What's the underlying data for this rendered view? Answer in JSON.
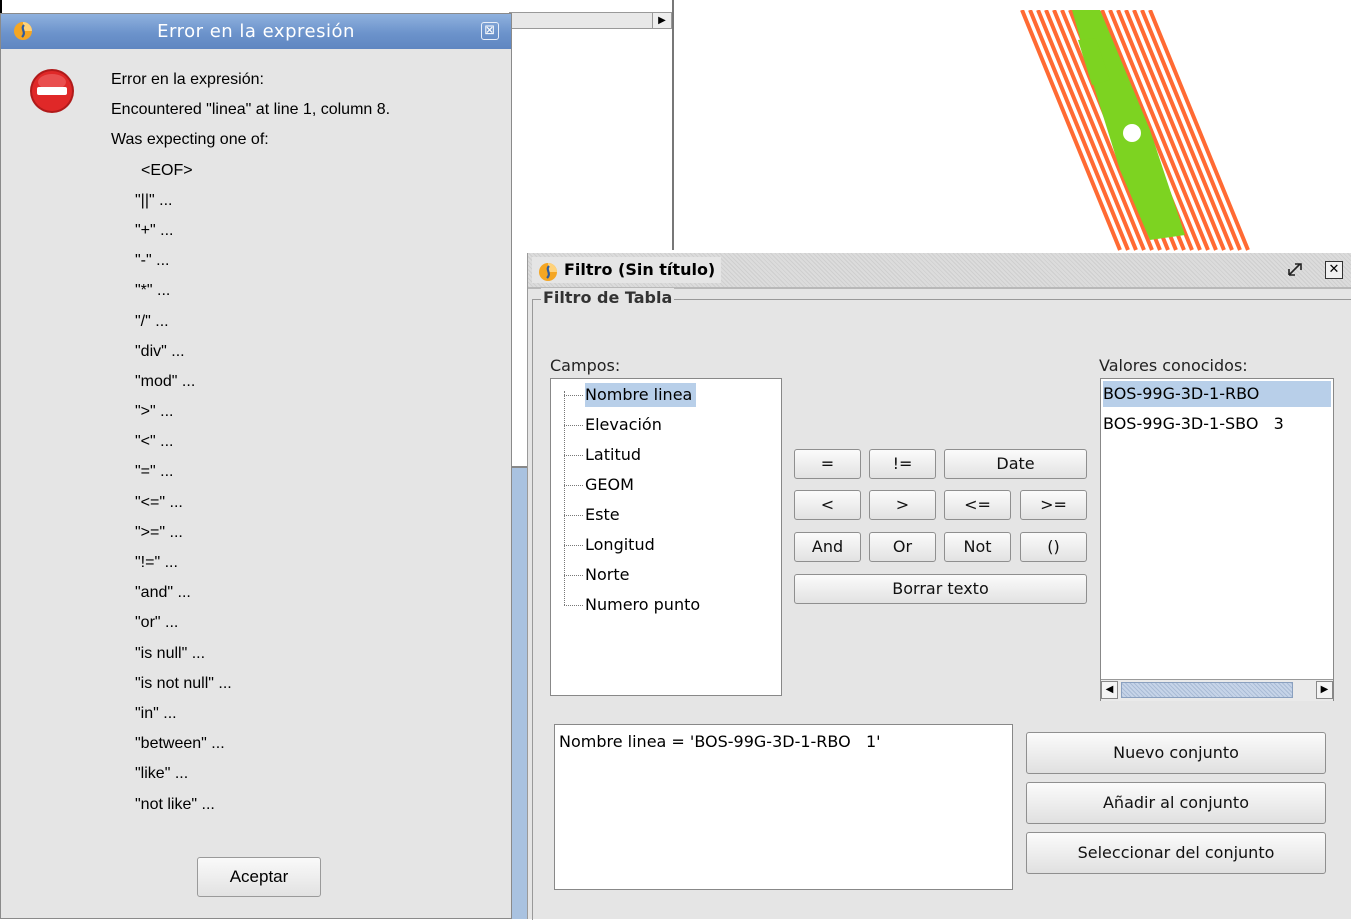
{
  "error_dialog": {
    "title": "Error en la expresión",
    "close_glyph": "⊠",
    "message_lines": [
      "Error en la expresión:",
      "Encountered \"linea\" at line 1, column 8.",
      "Was expecting one of:"
    ],
    "expected_tokens": [
      "<EOF>",
      "\"||\" ...",
      "\"+\" ...",
      "\"-\" ...",
      "\"*\" ...",
      "\"/\" ...",
      "\"div\" ...",
      "\"mod\" ...",
      "\">\" ...",
      "\"<\" ...",
      "\"=\" ...",
      "\"<=\" ...",
      "\">=\" ...",
      "\"!=\" ...",
      "\"and\" ...",
      "\"or\" ...",
      "\"is null\" ...",
      "\"is not null\" ...",
      "\"in\" ...",
      "\"between\" ...",
      "\"like\" ...",
      "\"not like\" ..."
    ],
    "accept_label": "Aceptar",
    "icon": "error-stop-icon"
  },
  "filter_window": {
    "title": "Filtro (Sin título)",
    "group_title": "Filtro de Tabla",
    "fields_label": "Campos:",
    "fields": [
      "Nombre linea",
      "Elevación",
      "Latitud",
      "GEOM",
      "Este",
      "Longitud",
      "Norte",
      "Numero punto"
    ],
    "selected_field": "Nombre linea",
    "operators": {
      "eq": "=",
      "neq": "!=",
      "date": "Date",
      "lt": "<",
      "gt": ">",
      "lte": "<=",
      "gte": ">=",
      "and": "And",
      "or": "Or",
      "not": "Not",
      "parens": "()",
      "clear": "Borrar texto"
    },
    "known_values_label": "Valores conocidos:",
    "known_values": [
      "BOS-99G-3D-1-RBO",
      "BOS-99G-3D-1-SBO   3"
    ],
    "expression": "Nombre linea = 'BOS-99G-3D-1-RBO   1'",
    "set_buttons": {
      "new_set": "Nuevo conjunto",
      "add_to_set": "Añadir al conjunto",
      "select_from_set": "Seleccionar del conjunto"
    }
  },
  "colors": {
    "titlebar_blue": "#6c93cb",
    "selection": "#b8cfe9",
    "map_orange": "#ff6a33",
    "map_green": "#7dd321"
  }
}
